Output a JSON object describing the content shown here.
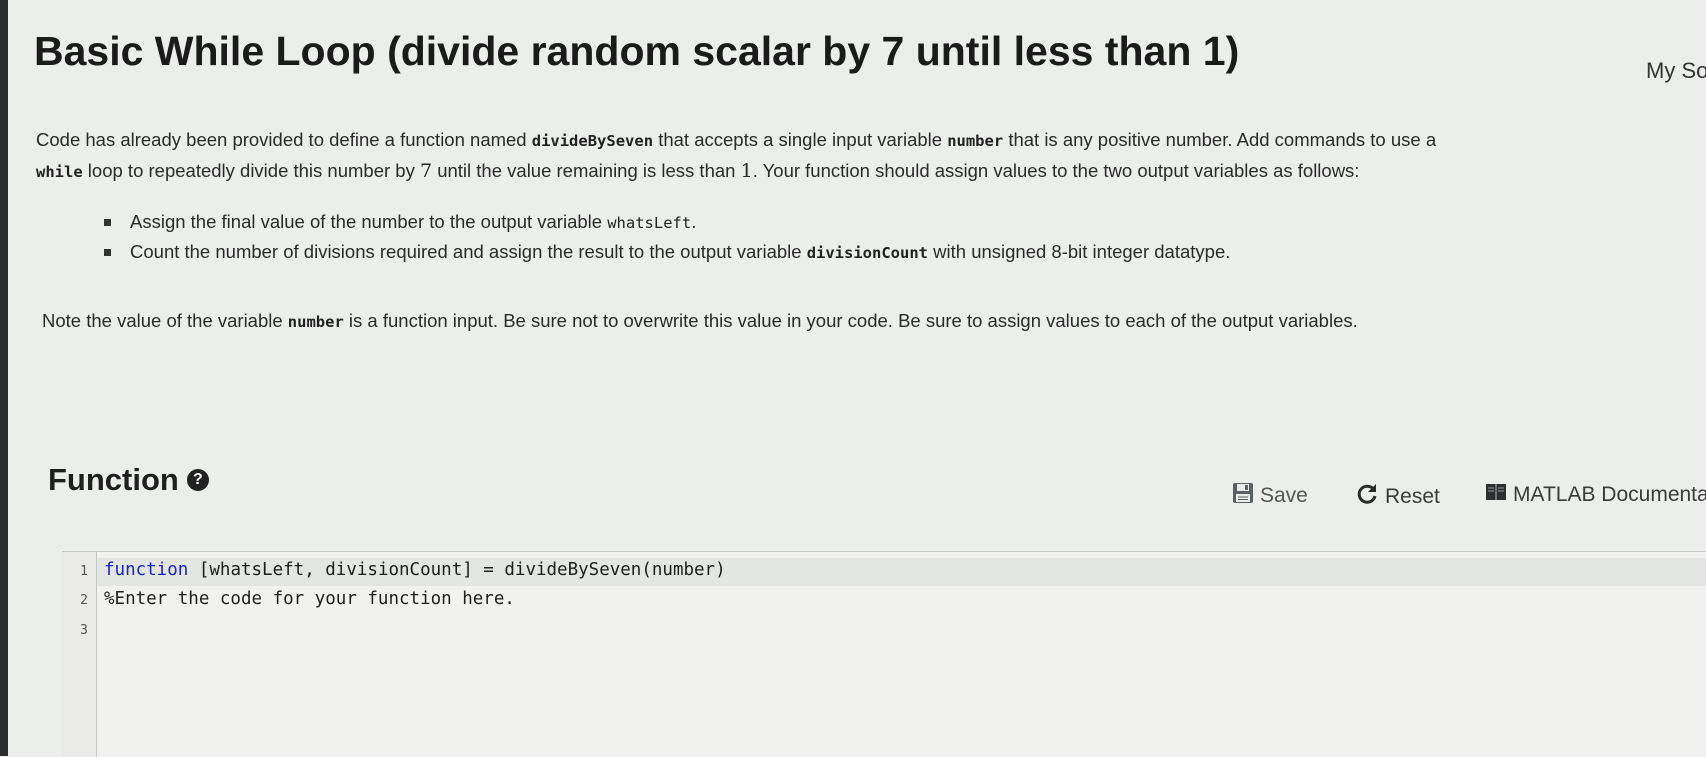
{
  "title": "Basic While Loop (divide random scalar by 7 until less than 1)",
  "header_link": "My So",
  "description": {
    "p1_a": "Code has already been provided to define a function named ",
    "p1_code1": "divideBySeven",
    "p1_b": " that accepts a single input variable ",
    "p1_code2": "number",
    "p1_c": " that is any positive number. Add commands to use a",
    "p2_code": "while",
    "p2_a": " loop to repeatedly divide this number by ",
    "p2_num1": "7",
    "p2_b": " until the value remaining is less than ",
    "p2_num2": "1",
    "p2_c": ". Your function should assign values to the two output variables as follows:"
  },
  "bullets": [
    {
      "text_a": "Assign the final value of the number to the output variable ",
      "code": "whatsLeft",
      "text_b": "."
    },
    {
      "text_a": "Count the number of divisions required and assign the result to the output variable ",
      "code": "divisionCount",
      "text_b": " with unsigned 8-bit integer datatype."
    }
  ],
  "note": {
    "a": "Note the value of the variable ",
    "code": "number",
    "b": " is a function input. Be sure not to overwrite this value in your code. Be sure to assign values to each of the output variables."
  },
  "function_section": {
    "heading": "Function",
    "help_icon": "question-circle-icon",
    "save_label": "Save",
    "reset_label": "Reset",
    "docs_label": "MATLAB Documenta"
  },
  "editor": {
    "line_numbers": [
      "1",
      "2",
      "3"
    ],
    "line1_keyword": "function",
    "line1_rest": " [whatsLeft, divisionCount] = divideBySeven(number)",
    "line2": "%Enter the code for your function here.",
    "line3": ""
  }
}
